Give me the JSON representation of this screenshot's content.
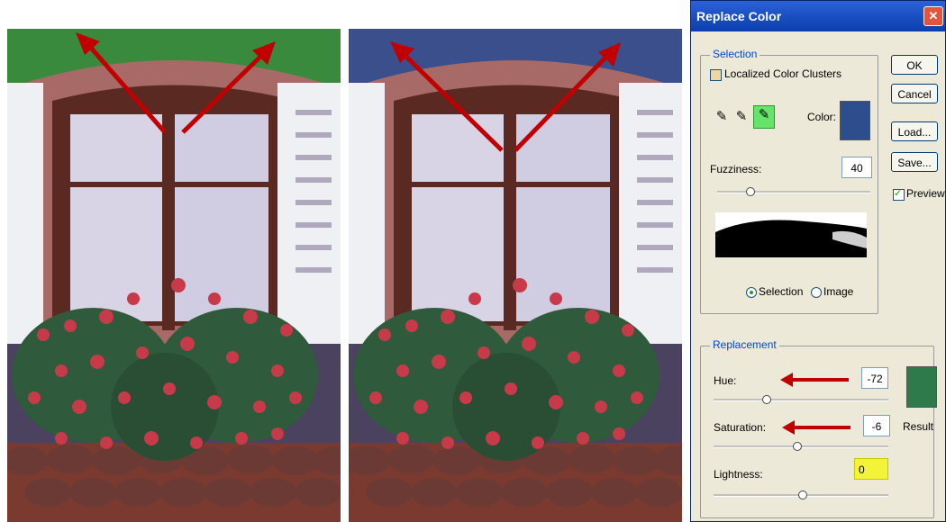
{
  "dialog": {
    "title": "Replace Color",
    "buttons": {
      "ok": "OK",
      "cancel": "Cancel",
      "load": "Load...",
      "save": "Save..."
    },
    "preview": {
      "label": "Preview",
      "checked": true
    },
    "selection": {
      "legend": "Selection",
      "localized_clusters": {
        "label": "Localized Color Clusters",
        "checked": false
      },
      "color_label": "Color:",
      "color_value": "#2e4d8c",
      "fuzziness": {
        "label": "Fuzziness:",
        "value": "40"
      },
      "view_options": {
        "selection": "Selection",
        "image": "Image",
        "selected": "selection"
      },
      "eyedroppers": [
        "eyedropper-icon",
        "eyedropper-plus-icon",
        "eyedropper-minus-icon"
      ]
    },
    "replacement": {
      "legend": "Replacement",
      "hue": {
        "label": "Hue:",
        "value": "-72"
      },
      "saturation": {
        "label": "Saturation:",
        "value": "-6"
      },
      "lightness": {
        "label": "Lightness:",
        "value": "0"
      },
      "result_label": "Result",
      "result_color": "#2f7a4a"
    }
  },
  "photos": {
    "before_sky_color": "#3a8a3e",
    "after_sky_color": "#3b4f8c",
    "arrow_color": "#c00000"
  }
}
